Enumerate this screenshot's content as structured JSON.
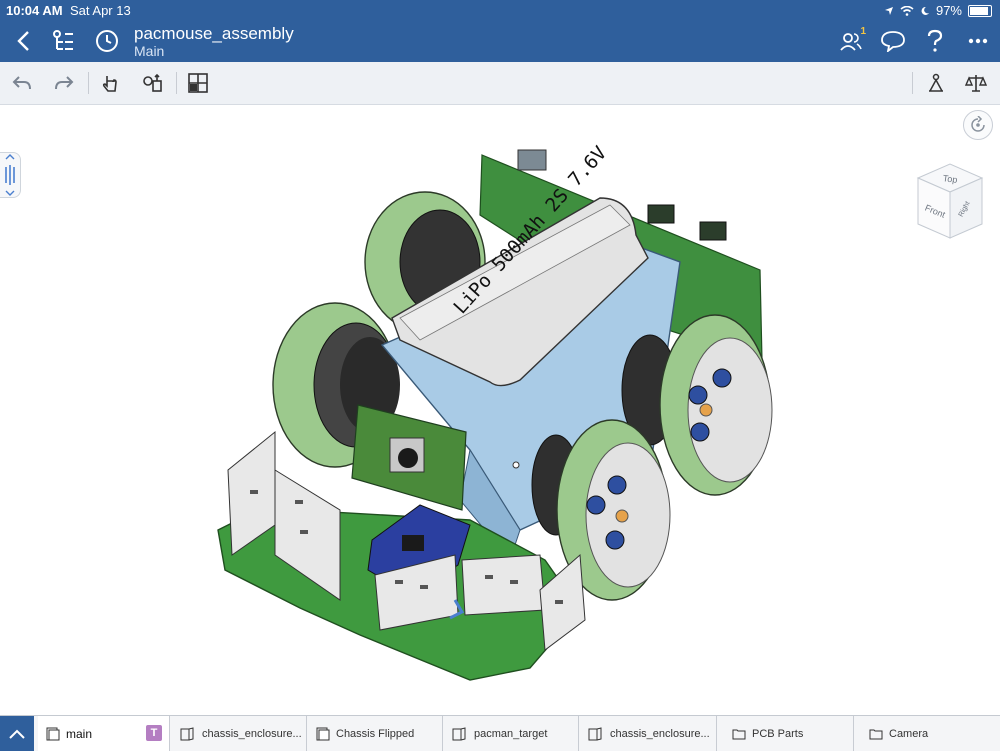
{
  "status_bar": {
    "time": "10:04 AM",
    "date": "Sat Apr 13",
    "battery": "97%"
  },
  "header": {
    "title": "pacmouse_assembly",
    "subtitle": "Main",
    "notification_count": "1",
    "icons": [
      "back-icon",
      "feature-tree-icon",
      "history-icon",
      "collaborators-icon",
      "comment-icon",
      "help-icon",
      "more-icon"
    ]
  },
  "toolbar": {
    "icons": [
      "undo-icon",
      "redo-icon",
      "select-icon",
      "mate-icon",
      "view-layout-icon",
      "mass-properties-icon",
      "measure-icon"
    ]
  },
  "model": {
    "battery_label": "LiPo 500mAh 2S 7.6V"
  },
  "view_cube": {
    "top": "Top",
    "front": "Front",
    "right": "Right"
  },
  "tabs": [
    {
      "label": "main",
      "icon": "assembly-tab-icon"
    },
    {
      "label": "chassis_enclosure...",
      "icon": "part-studio-icon"
    },
    {
      "label": "Chassis Flipped",
      "icon": "assembly-tab-icon"
    },
    {
      "label": "pacman_target",
      "icon": "part-studio-icon"
    },
    {
      "label": "chassis_enclosure...",
      "icon": "part-studio-icon"
    },
    {
      "label": "PCB Parts",
      "icon": "folder-icon"
    },
    {
      "label": "Camera",
      "icon": "folder-icon"
    }
  ],
  "tab_badge": "T",
  "colors": {
    "accent": "#2f5f9c",
    "pcb_green": "#3f9a3f",
    "wheel_green": "#9cc98d"
  }
}
